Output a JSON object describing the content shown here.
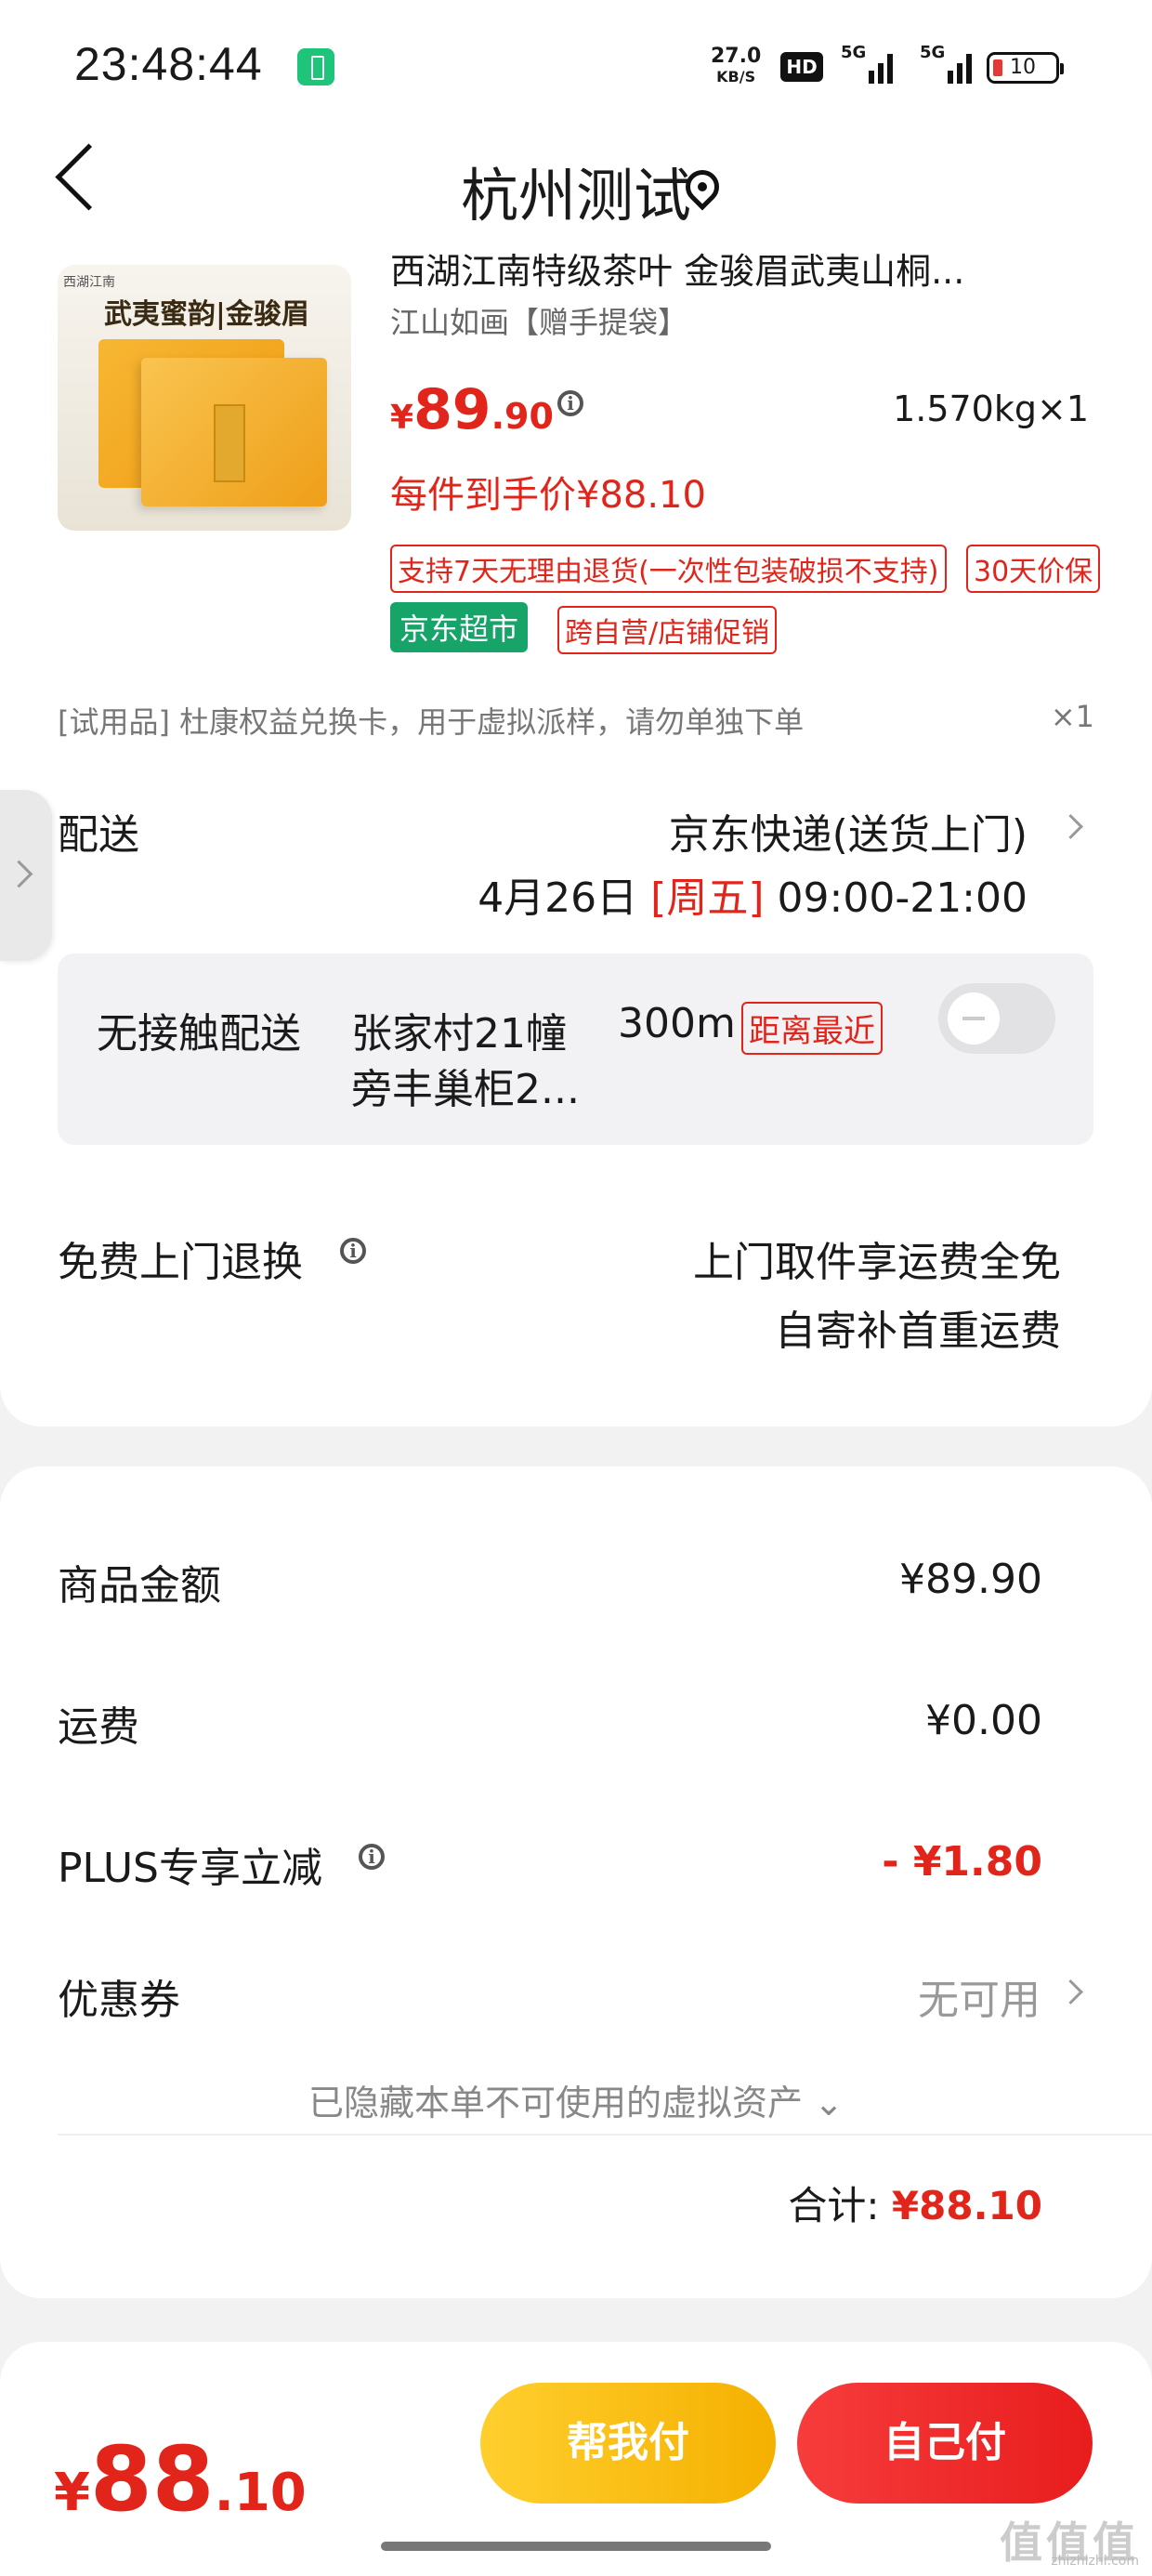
{
  "status": {
    "time": "23:48:44",
    "net_speed": "27.0",
    "net_unit": "KB/S",
    "hd": "HD",
    "sig1": "5G",
    "sig2": "5G",
    "battery": "10"
  },
  "header": {
    "title": "杭州测试"
  },
  "product": {
    "thumb_banner": "武夷蜜韵|金骏眉",
    "thumb_brand": "西湖江南",
    "name": "西湖江南特级茶叶 金骏眉武夷山桐...",
    "subtitle": "江山如画【赠手提袋】",
    "price_symbol": "¥",
    "price_int": "89",
    "price_dec": ".90",
    "weight": "1.570kg×1",
    "each_price": "每件到手价¥88.10",
    "tag_return": "支持7天无理由退货(一次性包装破损不支持)",
    "tag_price_protect": "30天价保",
    "tag_jd": "京东超市",
    "tag_promo": "跨自营/店铺促销"
  },
  "trial": {
    "text": "[试用品]  杜康权益兑换卡，用于虚拟派样，请勿单独下单",
    "qty": "×1"
  },
  "delivery": {
    "label": "配送",
    "method": "京东快递(送货上门)",
    "date": "4月26日",
    "weekday": "[周五]",
    "window": "09:00-21:00"
  },
  "contactless": {
    "label": "无接触配送",
    "locker_line1": "张家村21幢",
    "locker_line2": "旁丰巢柜2...",
    "distance": "300m",
    "nearest": "距离最近"
  },
  "return_service": {
    "label": "免费上门退换",
    "line1": "上门取件享运费全免",
    "line2": "自寄补首重运费"
  },
  "summary": {
    "goods_label": "商品金额",
    "goods_value": "¥89.90",
    "shipping_label": "运费",
    "shipping_value": "¥0.00",
    "plus_label": "PLUS专享立减",
    "plus_value": "- ¥1.80",
    "coupon_label": "优惠券",
    "coupon_value": "无可用",
    "hidden_note": "已隐藏本单不可使用的虚拟资产",
    "total_label": "合计:",
    "total_value": "¥88.10"
  },
  "footer": {
    "symbol": "¥",
    "total_int": "88",
    "total_dec": ".10",
    "help_pay": "帮我付",
    "self_pay": "自己付"
  },
  "watermark": {
    "main": "值值值",
    "site": "zhizhizhi.com"
  },
  "colors": {
    "accent_red": "#e1251b",
    "jd_green": "#16a469",
    "help_yellow": "#f5b000"
  }
}
